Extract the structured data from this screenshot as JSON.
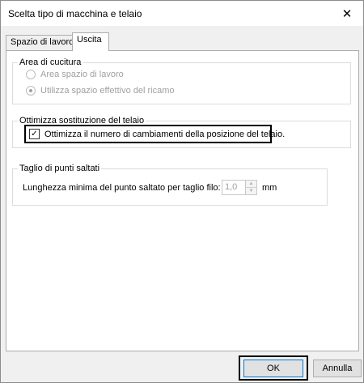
{
  "window": {
    "title": "Scelta tipo di macchina e telaio"
  },
  "tabs": [
    {
      "label": "Spazio di lavoro",
      "active": false
    },
    {
      "label": "Uscita",
      "active": true
    }
  ],
  "area_cucitura": {
    "legend": "Area di cucitura",
    "options": [
      {
        "label": "Area spazio di lavoro",
        "selected": false
      },
      {
        "label": "Utilizza spazio effettivo del ricamo",
        "selected": true
      }
    ]
  },
  "ottimizza": {
    "legend": "Ottimizza sostituzione del telaio",
    "checkbox_label": "Ottimizza il numero di cambiamenti della posizione del telaio.",
    "checked": true
  },
  "taglio": {
    "legend": "Taglio di punti saltati",
    "field_label": "Lunghezza minima del punto saltato per taglio filo:",
    "value": "1,0",
    "unit": "mm"
  },
  "buttons": {
    "ok": "OK",
    "cancel": "Annulla"
  }
}
